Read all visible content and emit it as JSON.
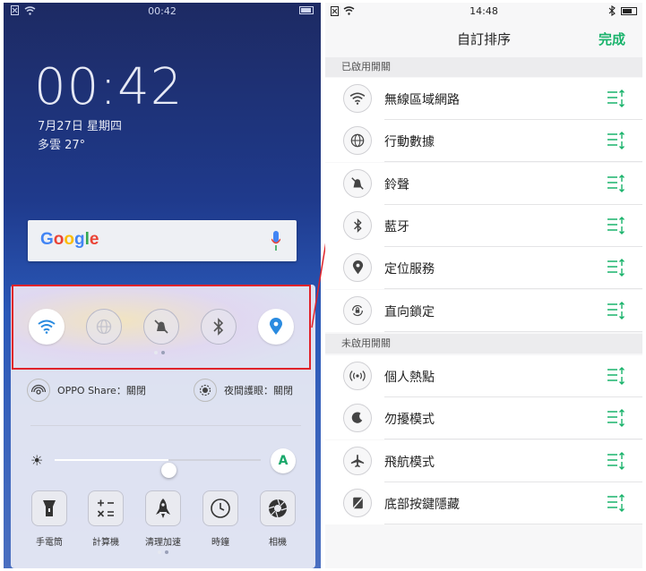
{
  "left": {
    "status": {
      "time": "00:42"
    },
    "lock": {
      "time": "00:42",
      "date": "7月27日 星期四",
      "weather": "多雲 27°"
    },
    "google": {
      "logo": "Google"
    },
    "quick_toggles": [
      {
        "icon": "wifi-icon",
        "state": "on"
      },
      {
        "icon": "globe-icon",
        "state": "off"
      },
      {
        "icon": "bell-off-icon",
        "state": "off"
      },
      {
        "icon": "bluetooth-icon",
        "state": "off"
      },
      {
        "icon": "location-pin-icon",
        "state": "on"
      }
    ],
    "oppo_share": "OPPO Share：關閉",
    "night_mode": "夜間護眼：關閉",
    "brightness": {
      "level": 0.55,
      "auto_label": "A"
    },
    "apps": [
      {
        "icon": "flashlight-icon",
        "label": "手電筒"
      },
      {
        "icon": "calculator-icon",
        "label": "計算機"
      },
      {
        "icon": "rocket-icon",
        "label": "清理加速"
      },
      {
        "icon": "clock-icon",
        "label": "時鐘"
      },
      {
        "icon": "camera-aperture-icon",
        "label": "相機"
      }
    ]
  },
  "right": {
    "status": {
      "time": "14:48"
    },
    "title": "自訂排序",
    "done": "完成",
    "enabled_header": "已啟用開關",
    "enabled": [
      {
        "icon": "wifi-icon",
        "label": "無線區域網路"
      },
      {
        "icon": "globe-icon",
        "label": "行動數據"
      },
      {
        "icon": "bell-off-icon",
        "label": "鈴聲"
      },
      {
        "icon": "bluetooth-icon",
        "label": "藍牙"
      },
      {
        "icon": "location-pin-icon",
        "label": "定位服務"
      },
      {
        "icon": "rotation-lock-icon",
        "label": "直向鎖定"
      }
    ],
    "disabled_header": "未啟用開關",
    "disabled": [
      {
        "icon": "hotspot-icon",
        "label": "個人熱點"
      },
      {
        "icon": "moon-icon",
        "label": "勿擾模式"
      },
      {
        "icon": "airplane-icon",
        "label": "飛航模式"
      },
      {
        "icon": "hide-nav-keys-icon",
        "label": "底部按鍵隱藏"
      }
    ]
  },
  "colors": {
    "accent": "#19b36b",
    "highlight": "#e0232a",
    "blue_toggle": "#2a8be0"
  }
}
